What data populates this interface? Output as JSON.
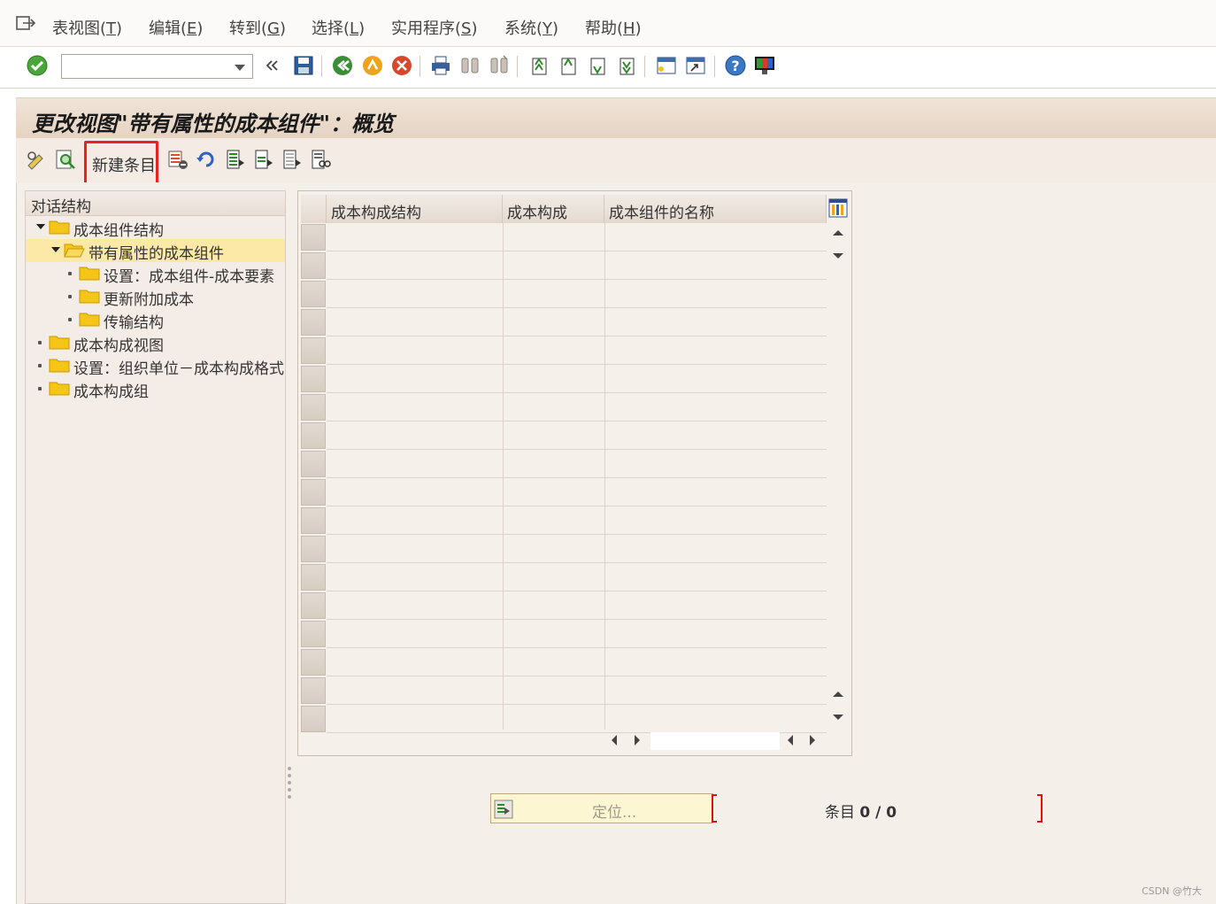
{
  "menubar": {
    "items": [
      {
        "label": "表视图(",
        "key": "T",
        "suffix": ")"
      },
      {
        "label": "编辑(",
        "key": "E",
        "suffix": ")"
      },
      {
        "label": "转到(",
        "key": "G",
        "suffix": ")"
      },
      {
        "label": "选择(",
        "key": "L",
        "suffix": ")"
      },
      {
        "label": "实用程序(",
        "key": "S",
        "suffix": ")"
      },
      {
        "label": "系统(",
        "key": "Y",
        "suffix": ")"
      },
      {
        "label": "帮助(",
        "key": "H",
        "suffix": ")"
      }
    ]
  },
  "command_field": {
    "value": ""
  },
  "title": "更改视图\"带有属性的成本组件\"：概览",
  "app_toolbar": {
    "new_entry_label": "新建条目"
  },
  "tree": {
    "header": "对话结构",
    "nodes": [
      {
        "label": "成本组件结构"
      },
      {
        "label": "带有属性的成本组件"
      },
      {
        "label": "设置：成本组件-成本要素"
      },
      {
        "label": "更新附加成本"
      },
      {
        "label": "传输结构"
      },
      {
        "label": "成本构成视图"
      },
      {
        "label": "设置：组织单位－成本构成格式"
      },
      {
        "label": "成本构成组"
      }
    ]
  },
  "table": {
    "columns": [
      "成本构成结构",
      "成本构成",
      "成本组件的名称"
    ]
  },
  "footer": {
    "locate_label": "定位...",
    "entries_label": "条目",
    "entries_count": "0 / 0"
  },
  "watermark": "CSDN @竹大"
}
